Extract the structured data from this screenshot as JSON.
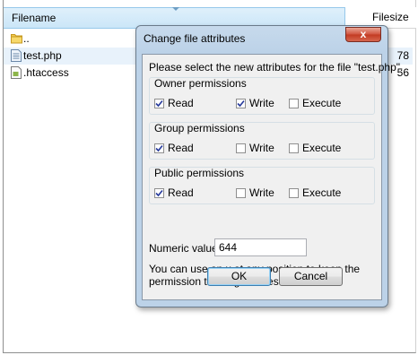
{
  "filelist": {
    "columns": {
      "filename": "Filename",
      "filesize": "Filesize"
    },
    "rows": [
      {
        "name": "..",
        "size": "",
        "icon": "folder-icon"
      },
      {
        "name": "test.php",
        "size": "78",
        "icon": "php-file-icon"
      },
      {
        "name": ".htaccess",
        "size": "56",
        "icon": "text-file-icon"
      }
    ]
  },
  "dialog": {
    "title": "Change file attributes",
    "close": "x",
    "prompt": "Please select the new attributes for the file \"test.php\".",
    "groups": [
      {
        "label": "Owner permissions",
        "read": "Read",
        "write": "Write",
        "execute": "Execute",
        "read_checked": true,
        "write_checked": true,
        "execute_checked": false
      },
      {
        "label": "Group permissions",
        "read": "Read",
        "write": "Write",
        "execute": "Execute",
        "read_checked": true,
        "write_checked": false,
        "execute_checked": false
      },
      {
        "label": "Public permissions",
        "read": "Read",
        "write": "Write",
        "execute": "Execute",
        "read_checked": true,
        "write_checked": false,
        "execute_checked": false
      }
    ],
    "numeric_label": "Numeric value:",
    "numeric_value": "644",
    "hint": "You can use an x at any position to keep the permission the original files have.",
    "ok": "OK",
    "cancel": "Cancel"
  },
  "colors": {
    "header_bg": "#cbe6f8",
    "dialog_frame": "#bcd2e8",
    "close_button": "#c23a22",
    "checkmark": "#26399b"
  }
}
